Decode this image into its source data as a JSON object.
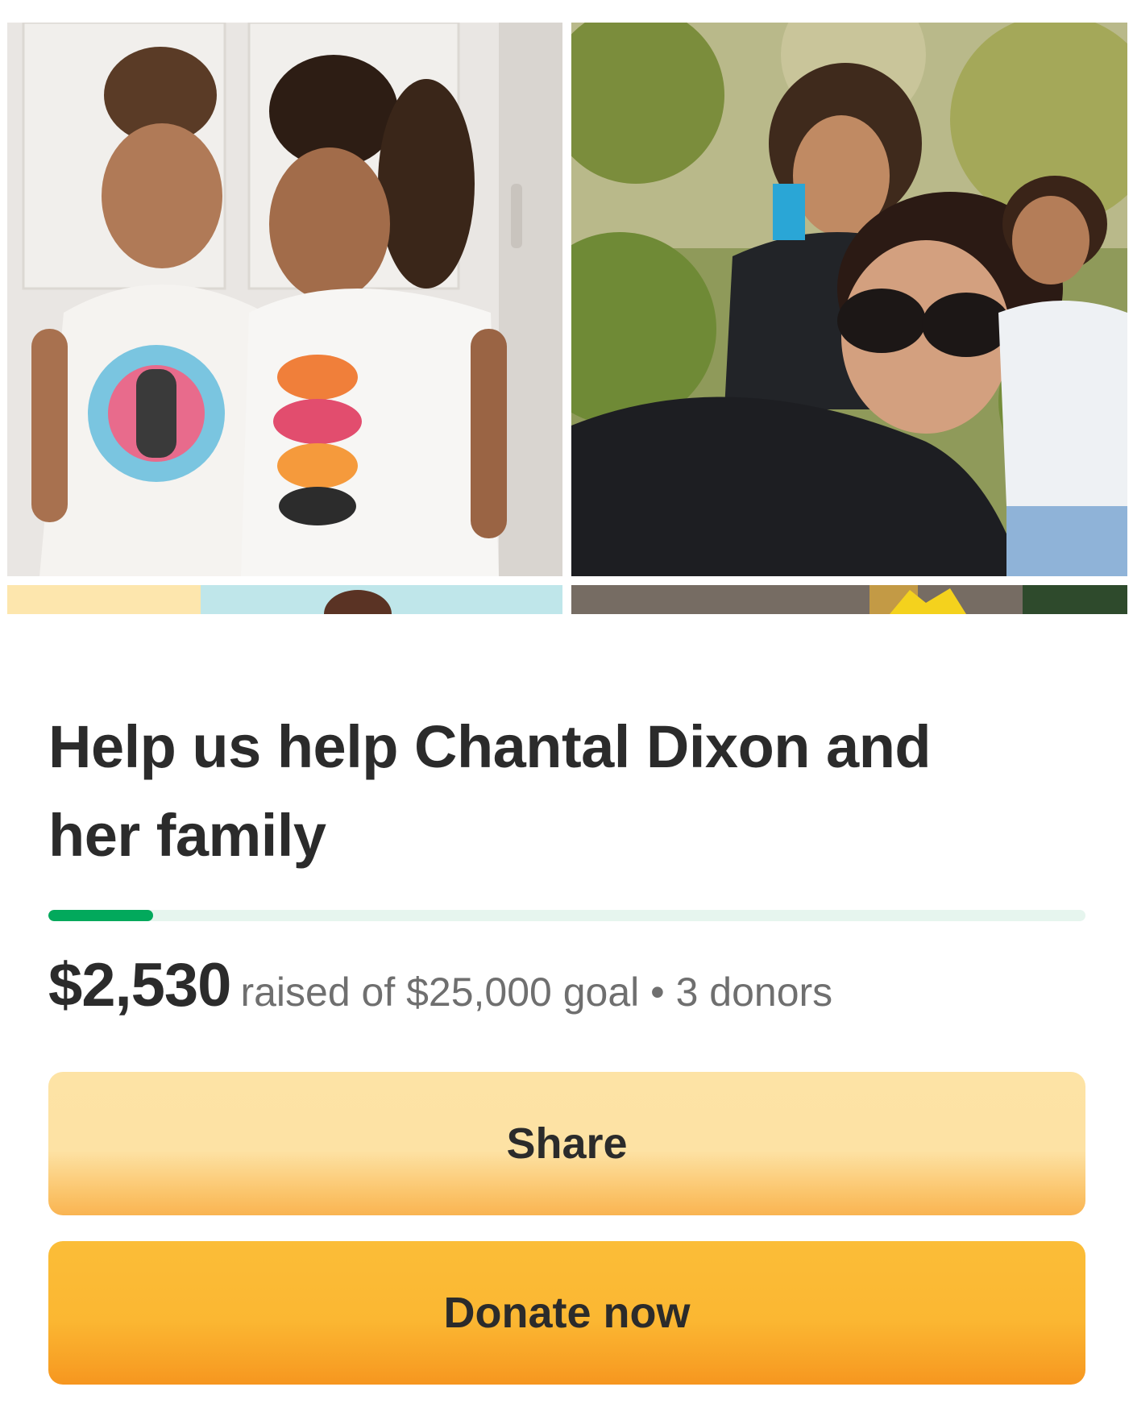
{
  "campaign": {
    "title": "Help us help Chantal Dixon and her family",
    "raised": "$2,530",
    "goal_text": "raised of $25,000 goal • 3 donors",
    "progress_fraction": 0.101
  },
  "actions": {
    "share_label": "Share",
    "donate_label": "Donate now"
  },
  "colors": {
    "progress_fill": "#02a95c",
    "progress_track": "#e6f5ee",
    "share_button": "#fde2a4",
    "donate_button": "#fbb732"
  }
}
